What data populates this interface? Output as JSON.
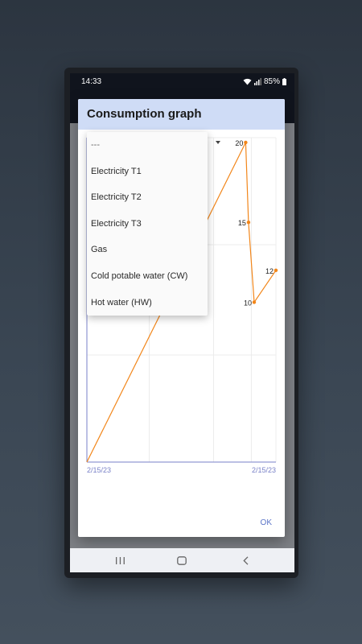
{
  "status": {
    "time": "14:33",
    "battery": "85%"
  },
  "dialog": {
    "title": "Consumption graph",
    "ok_label": "OK"
  },
  "dropdown": {
    "options": [
      "---",
      "Electricity T1",
      "Electricity T2",
      "Electricity T3",
      "Gas",
      "Cold potable water (CW)",
      "Hot water (HW)"
    ]
  },
  "chart_data": {
    "type": "line",
    "x_tick_labels": [
      "2/15/23",
      "2/15/23"
    ],
    "points": [
      {
        "x": 0.0,
        "y": 0
      },
      {
        "x": 0.84,
        "y": 20,
        "label": "20"
      },
      {
        "x": 0.855,
        "y": 15,
        "label": "15"
      },
      {
        "x": 0.885,
        "y": 10,
        "label": "10"
      },
      {
        "x": 1.0,
        "y": 12,
        "label": "12"
      }
    ],
    "ylim": [
      0,
      20.3
    ],
    "series_color": "#f2861a",
    "axis_color": "#7a82c8",
    "grid": true
  },
  "nav": {
    "recents_icon": "recents-icon",
    "home_icon": "home-icon",
    "back_icon": "back-icon"
  }
}
